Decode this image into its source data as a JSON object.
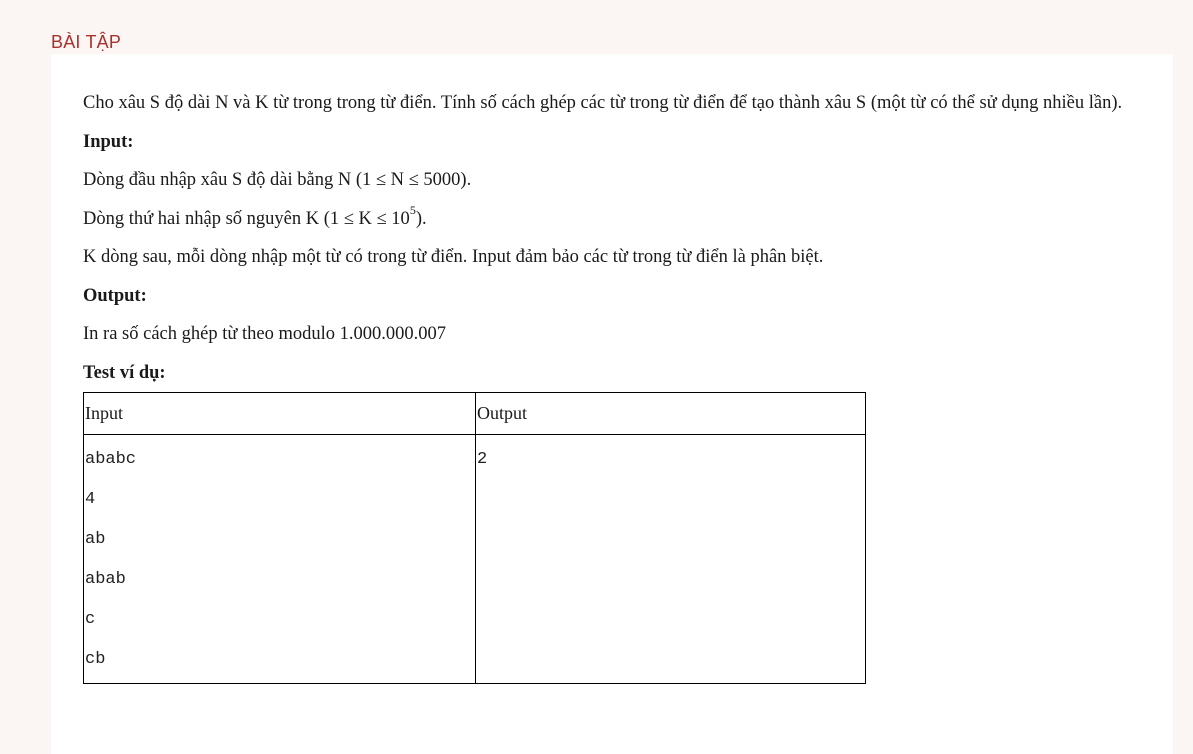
{
  "header": {
    "section_title": "BÀI TẬP"
  },
  "problem": {
    "statement": "Cho xâu S độ dài N và K từ trong trong từ điển. Tính số cách ghép các từ trong từ điển để tạo thành xâu S (một từ có thể sử dụng nhiều lần).",
    "input_heading": "Input:",
    "input_line1": "Dòng đầu nhập xâu S độ dài bằng N (1 ≤ N ≤ 5000).",
    "input_line2_prefix": "Dòng thứ hai nhập số nguyên K (1 ≤ K ≤ 10",
    "input_line2_sup": "5",
    "input_line2_suffix": ").",
    "input_line3": "K dòng sau, mỗi dòng nhập một từ có trong từ điển. Input đảm bảo các từ trong từ điển là phân biệt.",
    "output_heading": "Output:",
    "output_line1": "In ra số cách ghép từ theo modulo 1.000.000.007",
    "example_heading": "Test ví dụ:"
  },
  "example_table": {
    "headers": [
      "Input",
      "Output"
    ],
    "input_lines": [
      "ababc",
      "4",
      "ab",
      "abab",
      "c",
      "cb"
    ],
    "output_lines": [
      "2"
    ]
  }
}
